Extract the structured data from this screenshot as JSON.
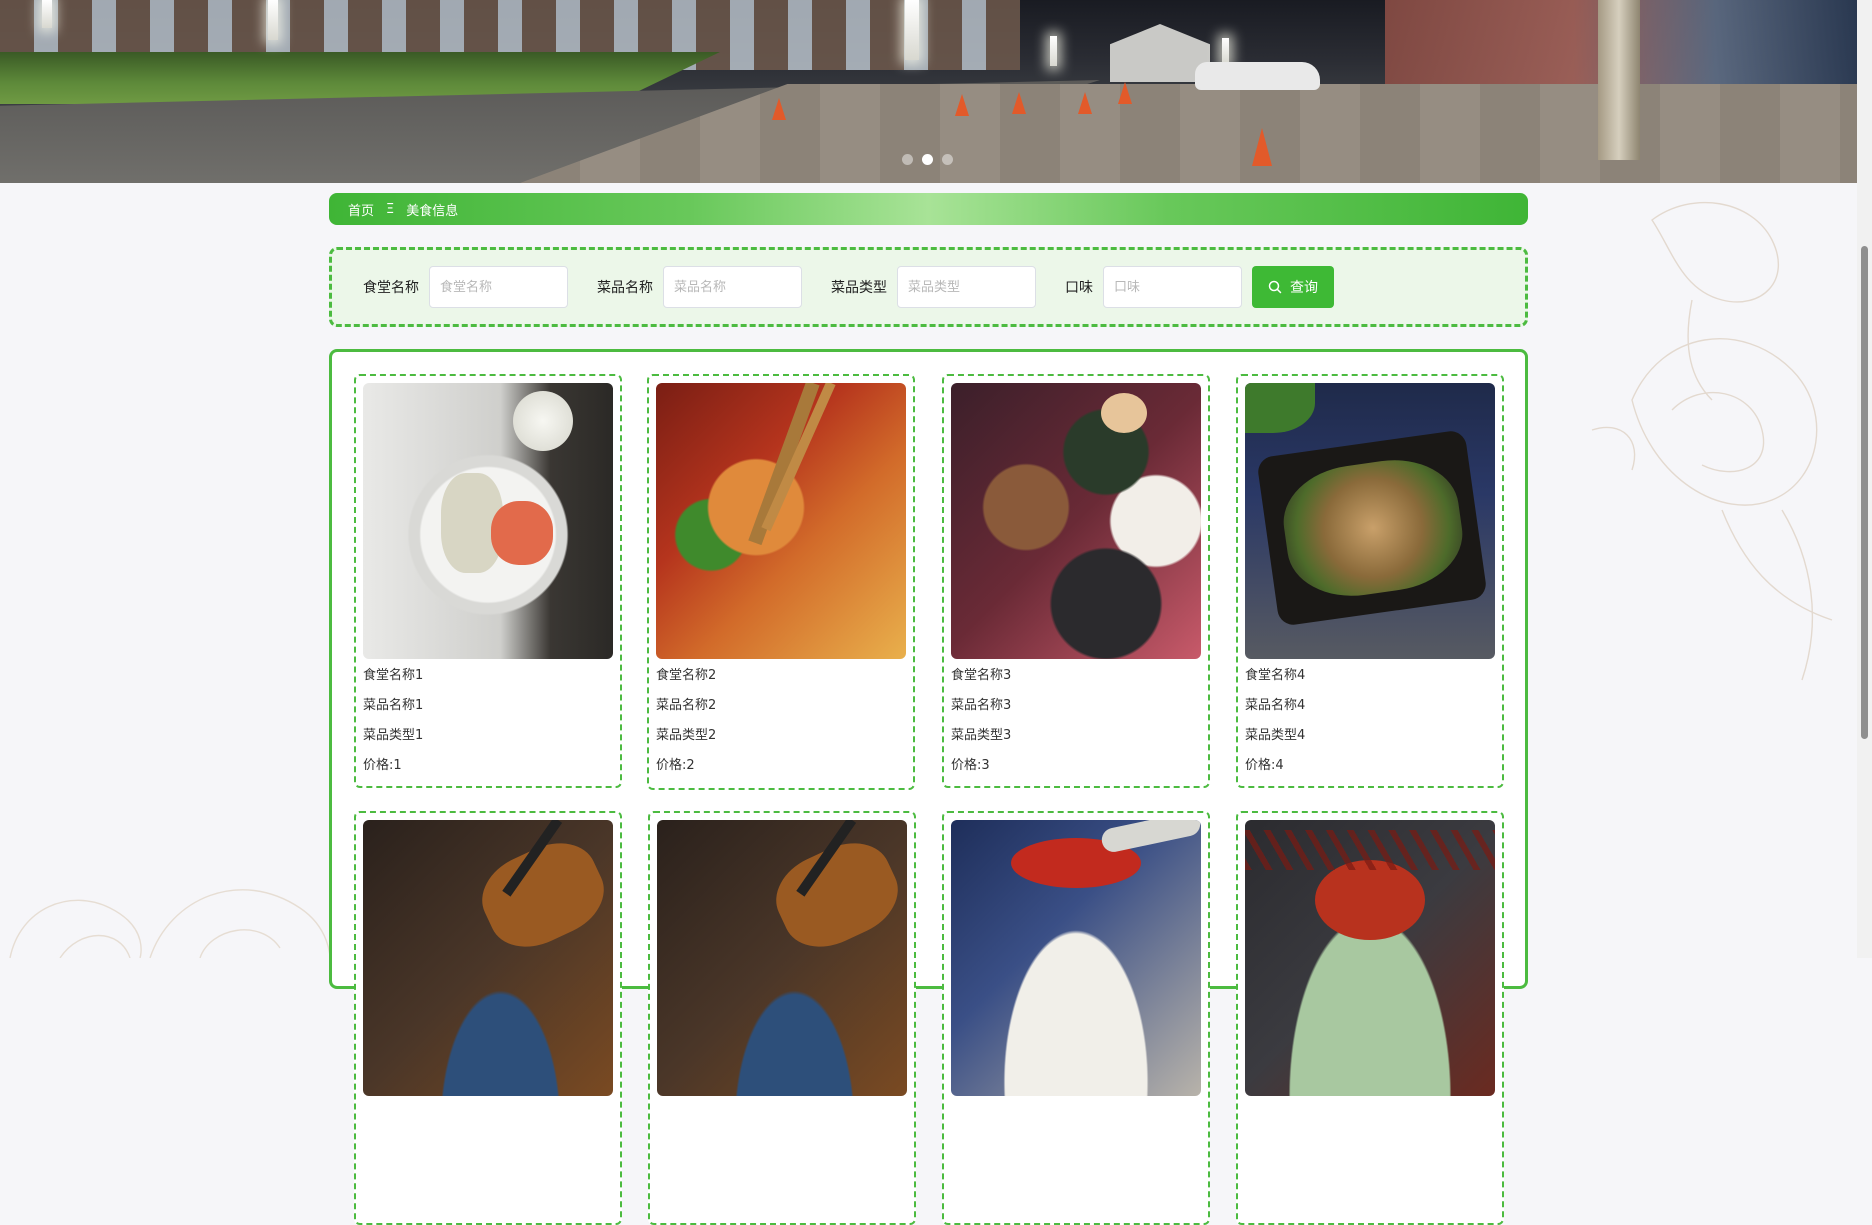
{
  "colors": {
    "accent": "#3eb935",
    "panel_bg": "#ecf7e9",
    "page_bg": "#f6f6f9"
  },
  "banner": {
    "slides": 3,
    "active_slide": 1
  },
  "breadcrumb": {
    "home": "首页",
    "separator": "Ξ",
    "current": "美食信息"
  },
  "search": {
    "fields": [
      {
        "label": "食堂名称",
        "placeholder": "食堂名称",
        "value": ""
      },
      {
        "label": "菜品名称",
        "placeholder": "菜品名称",
        "value": ""
      },
      {
        "label": "菜品类型",
        "placeholder": "菜品类型",
        "value": ""
      },
      {
        "label": "口味",
        "placeholder": "口味",
        "value": ""
      }
    ],
    "button_label": "查询",
    "button_icon": "search-icon"
  },
  "foods": [
    {
      "canteen": "食堂名称1",
      "dish": "菜品名称1",
      "type": "菜品类型1",
      "price": "价格:1",
      "photo": "shrimp-rice-plate"
    },
    {
      "canteen": "食堂名称2",
      "dish": "菜品名称2",
      "type": "菜品类型2",
      "price": "价格:2",
      "photo": "spicy-shrimp-chopsticks"
    },
    {
      "canteen": "食堂名称3",
      "dish": "菜品名称3",
      "type": "菜品类型3",
      "price": "价格:3",
      "photo": "banquet-table"
    },
    {
      "canteen": "食堂名称4",
      "dish": "菜品名称4",
      "type": "菜品类型4",
      "price": "价格:4",
      "photo": "stir-fried-clams"
    },
    {
      "photo": "braised-fish"
    },
    {
      "photo": "braised-fish"
    },
    {
      "photo": "chili-broth-bowl"
    },
    {
      "photo": "crayfish-chili"
    }
  ]
}
